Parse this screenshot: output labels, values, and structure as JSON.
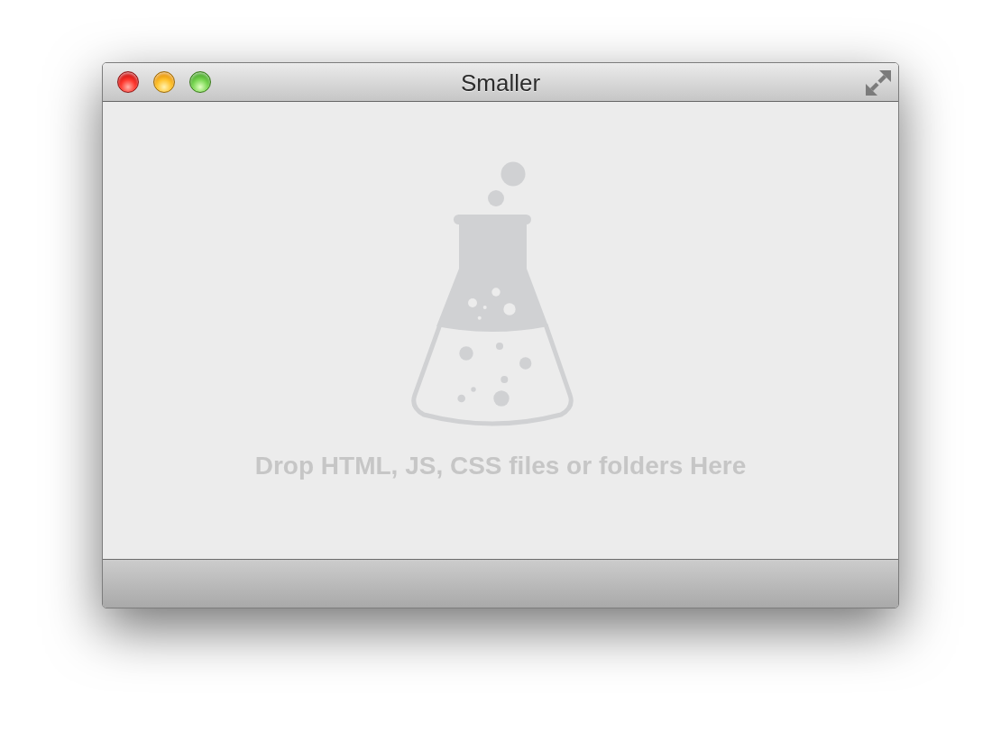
{
  "window": {
    "title": "Smaller"
  },
  "drop_zone": {
    "message": "Drop HTML, JS, CSS files or folders Here"
  }
}
